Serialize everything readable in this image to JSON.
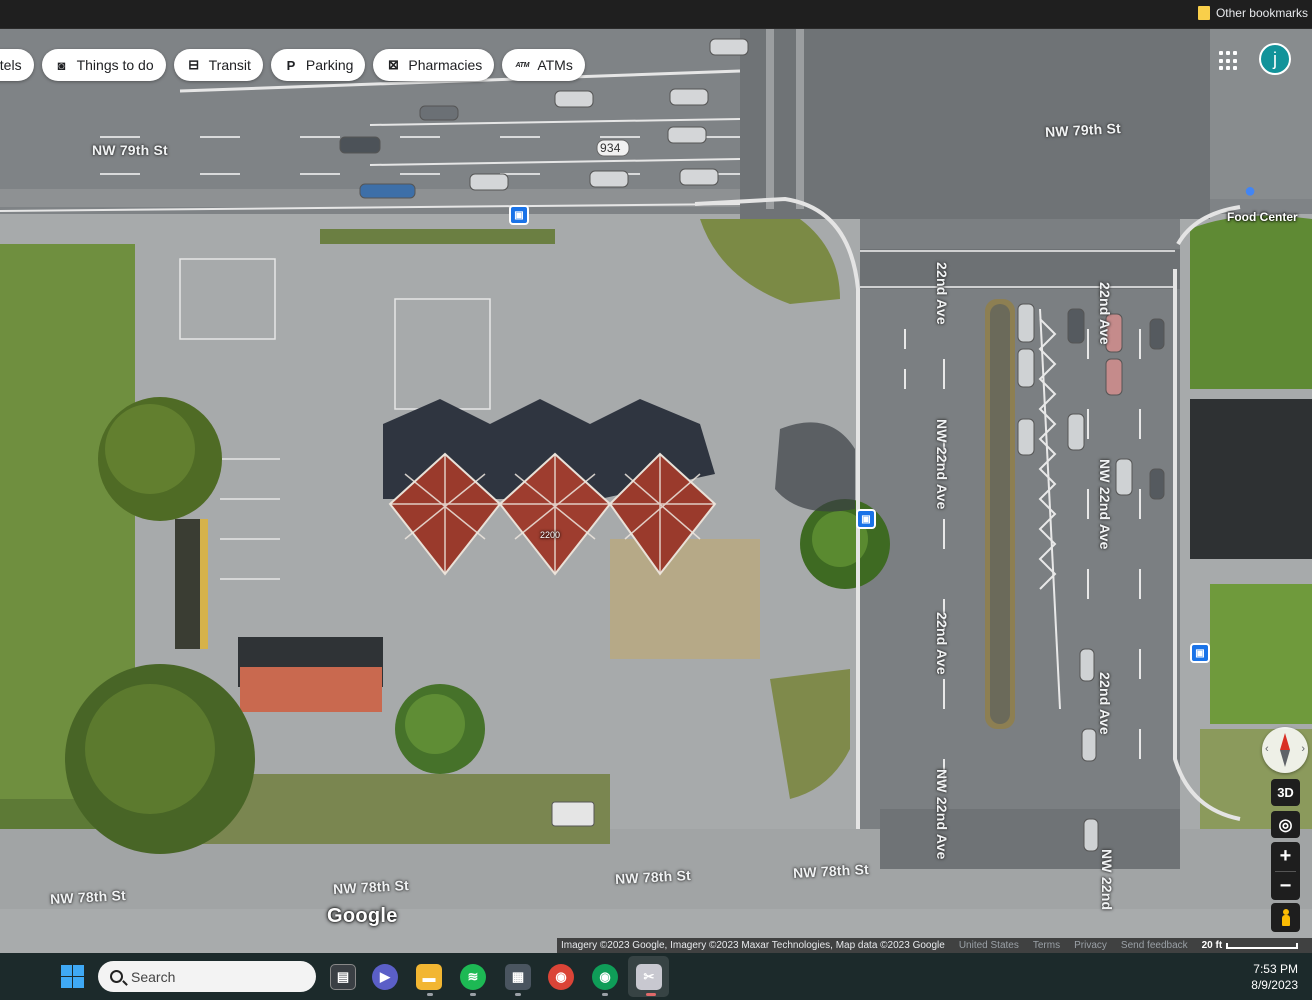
{
  "bookmarks": {
    "other_label": "Other bookmarks"
  },
  "chips": [
    {
      "label": "otels",
      "icon": "hotel-icon",
      "glyph": ""
    },
    {
      "label": "Things to do",
      "icon": "camera-icon",
      "glyph": "◙"
    },
    {
      "label": "Transit",
      "icon": "transit-icon",
      "glyph": "⊟"
    },
    {
      "label": "Parking",
      "icon": "parking-icon",
      "glyph": "P"
    },
    {
      "label": "Pharmacies",
      "icon": "pharmacy-icon",
      "glyph": "⊠"
    },
    {
      "label": "ATMs",
      "icon": "atm-icon",
      "glyph": "ATM"
    }
  ],
  "account": {
    "initial": "j",
    "color": "#12939a"
  },
  "streets": {
    "nw79_left": "NW 79th St",
    "nw79_right": "NW 79th St",
    "route_934": "934",
    "ave22_a": "22nd Ave",
    "ave22_b": "22nd Ave",
    "nw22_a": "NW 22nd Ave",
    "nw22_b": "NW 22nd Ave",
    "ave22_c": "22nd Ave",
    "ave22_d": "22nd Ave",
    "nw22_c": "NW 22nd Ave",
    "nw22_d": "NW 22nd",
    "nw78_a": "NW 78th St",
    "nw78_b": "NW 78th St",
    "nw78_c": "NW 78th St",
    "nw78_d": "NW 78th St"
  },
  "pois": {
    "food_center": "Food Center",
    "address_number": "2200"
  },
  "controls": {
    "three_d": "3D",
    "zoom_in": "+",
    "zoom_out": "−"
  },
  "google_logo": "Google",
  "attribution": {
    "imagery": "Imagery ©2023 Google, Imagery ©2023 Maxar Technologies, Map data ©2023 Google",
    "country": "United States",
    "terms": "Terms",
    "privacy": "Privacy",
    "feedback": "Send feedback",
    "scale": "20 ft"
  },
  "taskbar": {
    "search_placeholder": "Search",
    "time": "7:53 PM",
    "date": "8/9/2023"
  },
  "colors": {
    "map_blue": "#1a73e8",
    "taskbar": "#1c2a2b",
    "grass": "#6b8a3a",
    "asphalt": "#8a8d90"
  }
}
